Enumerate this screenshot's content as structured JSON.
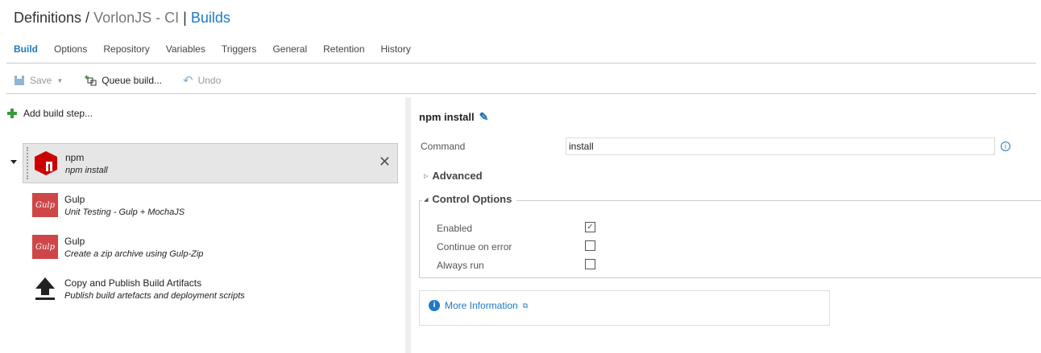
{
  "header": {
    "breadcrumb_root": "Definitions /",
    "definition": "VorlonJS - CI",
    "separator": "|",
    "section": "Builds"
  },
  "tabs": [
    {
      "label": "Build",
      "active": true
    },
    {
      "label": "Options"
    },
    {
      "label": "Repository"
    },
    {
      "label": "Variables"
    },
    {
      "label": "Triggers"
    },
    {
      "label": "General"
    },
    {
      "label": "Retention"
    },
    {
      "label": "History"
    }
  ],
  "toolbar": {
    "save": "Save",
    "queue": "Queue build...",
    "undo": "Undo"
  },
  "add_step": "Add build step...",
  "steps": [
    {
      "name": "npm",
      "desc": "npm install",
      "icon": "npm-icon",
      "selected": true
    },
    {
      "name": "Gulp",
      "desc": "Unit Testing - Gulp + MochaJS",
      "icon": "gulp-icon",
      "icon_text": "Gulp"
    },
    {
      "name": "Gulp",
      "desc": "Create a zip archive using Gulp-Zip",
      "icon": "gulp-icon",
      "icon_text": "Gulp"
    },
    {
      "name": "Copy and Publish Build Artifacts",
      "desc": "Publish build artefacts and deployment scripts",
      "icon": "upload-icon"
    }
  ],
  "detail": {
    "title": "npm install",
    "command_label": "Command",
    "command_value": "install",
    "advanced": "Advanced",
    "control_options": "Control Options",
    "options": [
      {
        "label": "Enabled",
        "checked": true
      },
      {
        "label": "Continue on error",
        "checked": false
      },
      {
        "label": "Always run",
        "checked": false
      }
    ],
    "more_info": "More Information"
  }
}
